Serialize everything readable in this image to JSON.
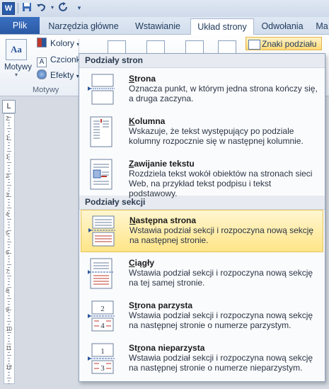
{
  "qat": {
    "logo": "W",
    "save_icon": "save-icon",
    "undo_icon": "undo-icon",
    "redo_icon": "redo-icon",
    "customize_icon": "chevron-down-icon"
  },
  "tabs": [
    {
      "label": "Plik"
    },
    {
      "label": "Narzędzia główne"
    },
    {
      "label": "Wstawianie"
    },
    {
      "label": "Układ strony"
    },
    {
      "label": "Odwołania"
    },
    {
      "label": "Ma"
    }
  ],
  "ribbon": {
    "themes_label": "Motywy",
    "themes_icon_text": "Aa",
    "colors_label": "Kolory",
    "fonts_label": "Czcionk",
    "effects_label": "Efekty",
    "group_label": "Motywy",
    "breaks_button": "Znaki podziału"
  },
  "ruler_corner": "L",
  "ruler_numbers": [
    "2",
    "1",
    "1",
    "2",
    "3",
    "4",
    "5",
    "6",
    "7",
    "8",
    "9",
    "10",
    "11",
    "12"
  ],
  "menu": {
    "page_breaks_heading": "Podziały stron",
    "section_breaks_heading": "Podziały sekcji",
    "items": [
      {
        "key": "S",
        "rest": "trona",
        "desc": "Oznacza punkt, w którym jedna strona kończy się, a druga zaczyna."
      },
      {
        "key": "K",
        "rest": "olumna",
        "desc": "Wskazuje, że tekst występujący po podziale kolumny rozpocznie się w następnej kolumnie."
      },
      {
        "key": "Z",
        "rest": "awijanie tekstu",
        "desc": "Rozdziela tekst wokół obiektów na stronach sieci Web, na przykład tekst podpisu i tekst podstawowy."
      },
      {
        "key": "N",
        "rest": "astępna strona",
        "desc": "Wstawia podział sekcji i rozpoczyna nową sekcję na następnej stronie."
      },
      {
        "key": "C",
        "rest": "iągły",
        "desc": "Wstawia podział sekcji i rozpoczyna nową sekcję na tej samej stronie."
      },
      {
        "pre": "S",
        "key": "t",
        "rest": "rona parzysta",
        "desc": "Wstawia podział sekcji i rozpoczyna nową sekcję na następnej stronie o numerze parzystym."
      },
      {
        "pre": "St",
        "key": "r",
        "rest": "ona nieparzysta",
        "desc": "Wstawia podział sekcji i rozpoczyna nową sekcję na następnej stronie o numerze nieparzystym."
      }
    ],
    "even_page_numbers": [
      "2",
      "4"
    ],
    "odd_page_numbers": [
      "1",
      "3"
    ]
  },
  "colors": {
    "highlight": "#ffe588",
    "file_tab": "#2b579a",
    "accent_red": "#c0392b"
  }
}
